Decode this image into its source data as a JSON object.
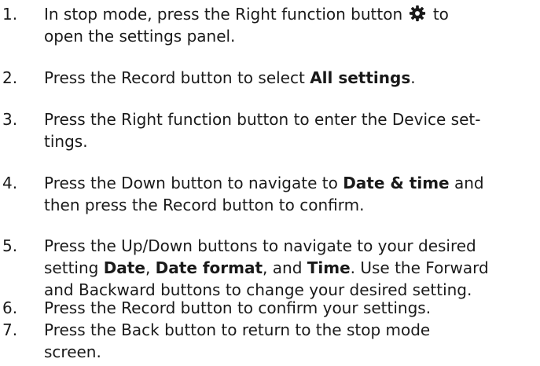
{
  "steps": [
    {
      "number": "1.",
      "line1_a": "In stop mode, press the Right function button",
      "line1_b": "to",
      "line2": "open the settings panel.",
      "icon": "gear-icon"
    },
    {
      "number": "2.",
      "text_a": "Press the Record button to select ",
      "bold_a": "All settings",
      "text_b": "."
    },
    {
      "number": "3.",
      "line1": "Press the Right function button to enter the Device set-",
      "line2": "tings."
    },
    {
      "number": "4.",
      "line1_a": "Press the Down button to navigate to ",
      "line1_bold": "Date & time",
      "line1_b": " and",
      "line2": "then press the Record button to confirm."
    },
    {
      "number": "5.",
      "line1": "Press the Up/Down buttons to navigate to your desired",
      "line2_a": "setting ",
      "line2_bold1": "Date",
      "line2_b": ", ",
      "line2_bold2": "Date format",
      "line2_c": ", and ",
      "line2_bold3": "Time",
      "line2_d": ". Use the Forward",
      "line3": "and Backward buttons to change your desired setting."
    },
    {
      "number": "6.",
      "text": "Press the Record button to confirm your settings."
    },
    {
      "number": "7.",
      "line1": "Press the Back button to return to the stop mode",
      "line2": "screen."
    }
  ]
}
